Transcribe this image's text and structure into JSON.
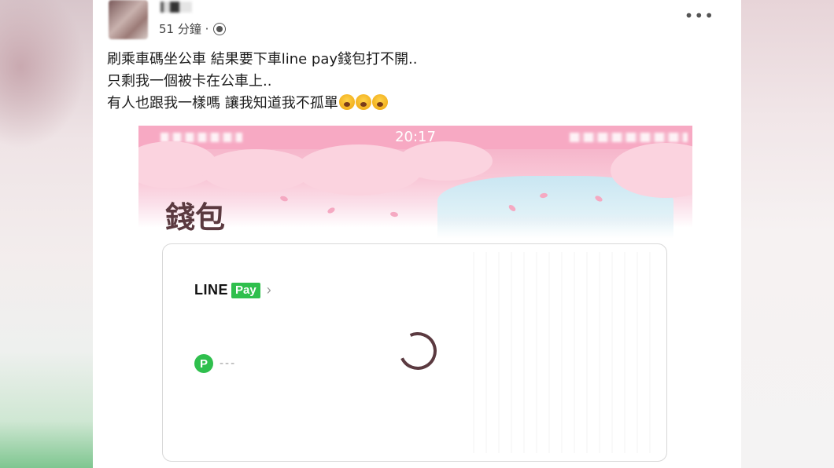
{
  "post": {
    "time_ago": "51 分鐘 ·",
    "more_label": "•••",
    "lines": [
      "刷乘車碼坐公車 結果要下車line pay錢包打不開..",
      "只剩我一個被卡在公車上..",
      "有人也跟我一樣嗎 讓我知道我不孤單"
    ],
    "emoji": "crying-face-emoji"
  },
  "screenshot": {
    "status_time": "20:17",
    "wallet_title": "錢包",
    "line_label": "LINE",
    "pay_label": "Pay",
    "chevron": "›",
    "points_icon": "P",
    "points_value": "---",
    "spinner": "loading-spinner"
  },
  "colors": {
    "status_bar": "#f7a9c3",
    "line_green": "#2fbf4d",
    "title_color": "#5b3a40"
  }
}
